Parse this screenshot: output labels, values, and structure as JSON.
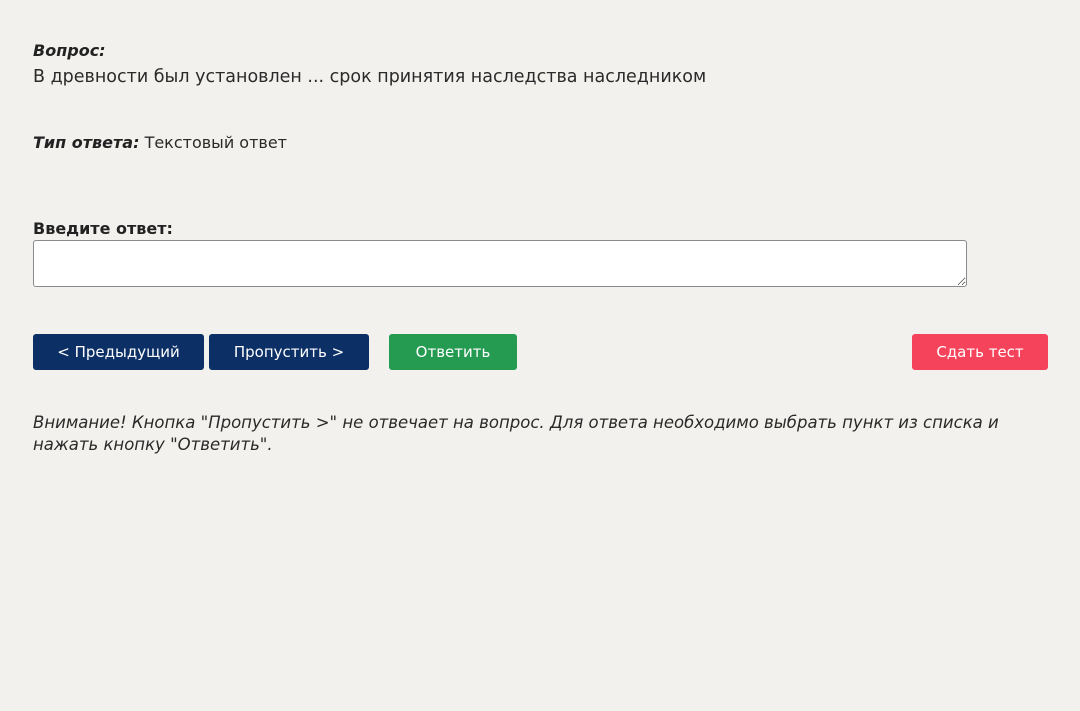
{
  "question": {
    "label": "Вопрос:",
    "text": "В древности был установлен ... срок принятия наследства наследником"
  },
  "answer_type": {
    "label": "Тип ответа:",
    "value": "Текстовый ответ"
  },
  "answer_input": {
    "label": "Введите ответ:",
    "value": "",
    "placeholder": ""
  },
  "buttons": {
    "prev_label": "< Предыдущий",
    "skip_label": "Пропустить >",
    "answer_label": "Ответить",
    "submit_label": "Сдать тест"
  },
  "warning": {
    "text": "Внимание! Кнопка \"Пропустить >\" не отвечает на вопрос. Для ответа необходимо выбрать пункт из списка и нажать кнопку \"Ответить\"."
  },
  "colors": {
    "background": "#f2f1ee",
    "primary_navy": "#0c3066",
    "answer_green": "#259b52",
    "submit_red": "#f4435b"
  }
}
